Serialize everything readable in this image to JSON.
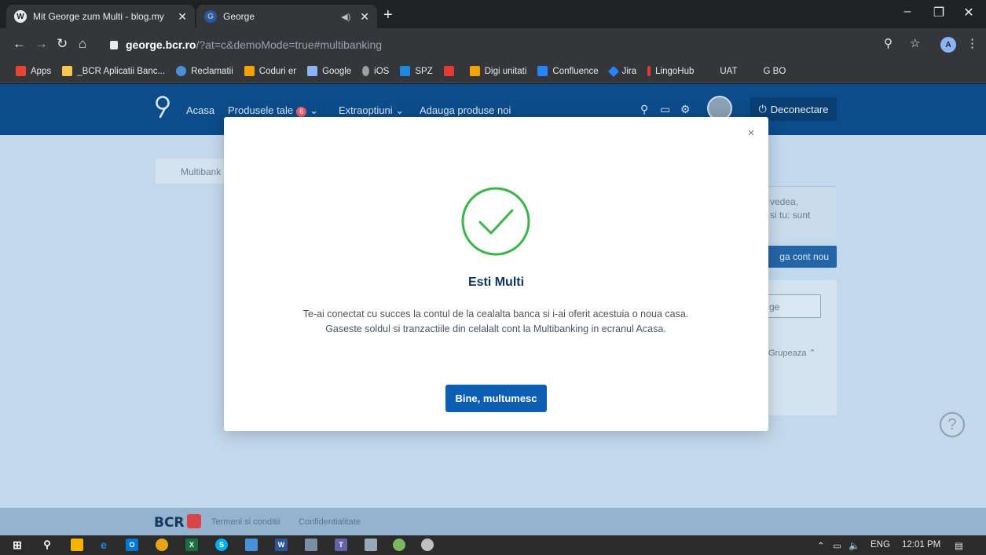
{
  "browser": {
    "tabs": [
      {
        "title": "Mit George zum Multi - blog.my",
        "favicon": "wordpress-icon"
      },
      {
        "title": "George",
        "favicon": "george-icon"
      }
    ],
    "new_tab": "+",
    "url_host": "george.bcr.ro",
    "url_rest": "/?at=c&demoMode=true#multibanking",
    "profile_initial": "A",
    "bookmarks": [
      "Apps",
      "_BCR Aplicatii Banc...",
      "Reclamatii",
      "Coduri er",
      "Google",
      "iOS",
      "SPZ",
      "",
      "Digi unitati",
      "Confluence",
      "Jira",
      "LingoHub",
      "UAT",
      "G BO"
    ]
  },
  "george": {
    "nav": {
      "home": "Acasa",
      "products": "Produsele tale",
      "products_badge": "6",
      "extras": "Extraoptiuni",
      "add_products": "Adauga produse noi"
    },
    "logout": "Deconectare",
    "background": {
      "tab_label": "Multibank",
      "snippet_1": "vedea,",
      "snippet_2": "si tu: sunt",
      "add_account_btn": "ga cont nou",
      "field_text": "ge",
      "group_label": "Grupeaza"
    },
    "footer": {
      "brand": "BCR",
      "terms": "Termeni si conditii",
      "privacy": "Confidentialitate"
    }
  },
  "modal": {
    "title": "Esti Multi",
    "body": "Te-ai conectat cu succes la contul de la cealalta banca si i-ai oferit acestuia o noua casa. Gaseste soldul si tranzactiile din celalalt cont la Multibanking in ecranul Acasa.",
    "button": "Bine, multumesc",
    "close": "×",
    "success_color": "#3bb54a"
  },
  "taskbar": {
    "language": "ENG",
    "time": "12:01 PM"
  }
}
